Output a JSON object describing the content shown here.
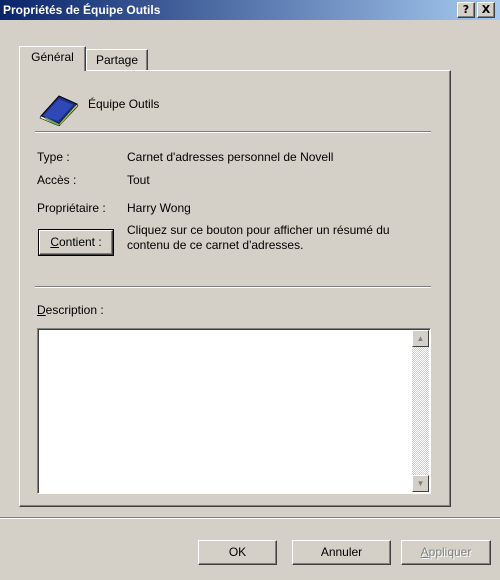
{
  "window": {
    "title": "Propriétés de Équipe Outils",
    "help_glyph": "?",
    "close_glyph": "X"
  },
  "tabs": [
    {
      "label": "Général",
      "active": true
    },
    {
      "label": "Partage",
      "active": false
    }
  ],
  "header": {
    "icon": "address-book-icon",
    "name": "Équipe Outils"
  },
  "info": {
    "type_label": "Type :",
    "type_value": "Carnet d'adresses personnel de Novell",
    "access_label": "Accès :",
    "access_value": "Tout",
    "owner_label": "Propriétaire :",
    "owner_value": "Harry Wong",
    "contents_button_underlined": "C",
    "contents_button_rest": "ontient :",
    "contents_help": "Cliquez sur ce bouton pour afficher un résumé du contenu de ce carnet d'adresses."
  },
  "description": {
    "label_underlined": "D",
    "label_rest": "escription :",
    "value": ""
  },
  "footer": {
    "ok_label": "OK",
    "cancel_label": "Annuler",
    "apply_underlined": "A",
    "apply_rest": "ppliquer"
  }
}
